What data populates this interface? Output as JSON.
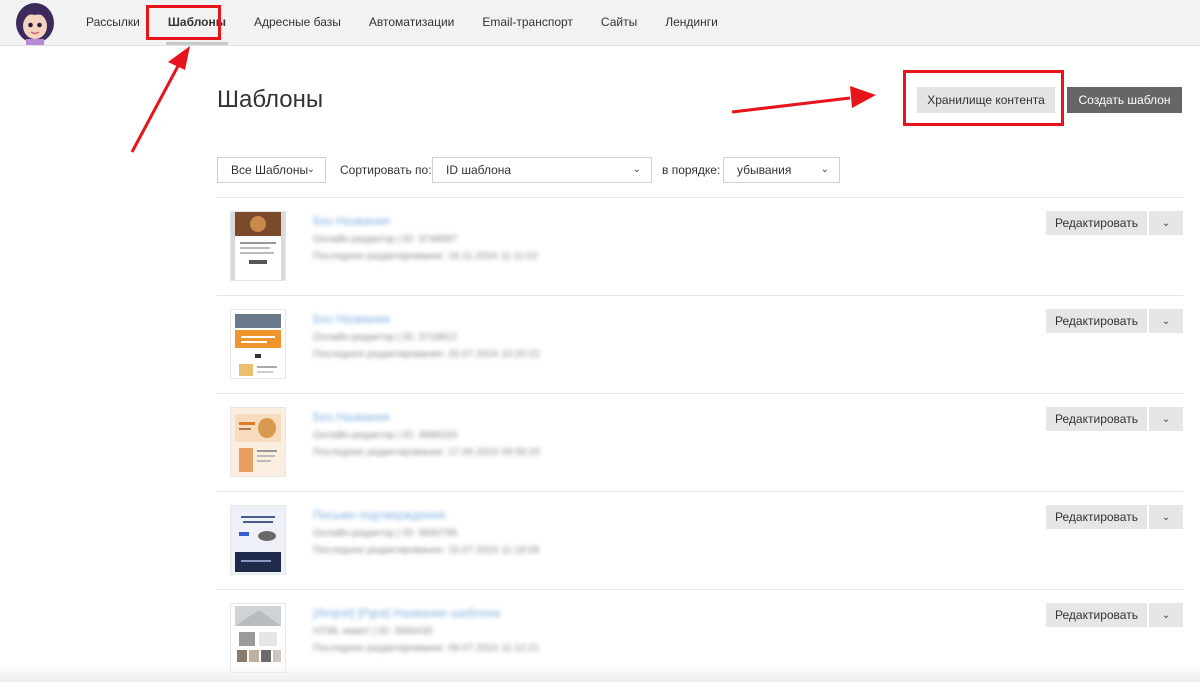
{
  "nav": {
    "items": [
      {
        "label": "Рассылки"
      },
      {
        "label": "Шаблоны",
        "active": true
      },
      {
        "label": "Адресные базы"
      },
      {
        "label": "Автоматизации"
      },
      {
        "label": "Email-транспорт"
      },
      {
        "label": "Сайты"
      },
      {
        "label": "Лендинги"
      }
    ]
  },
  "page": {
    "title": "Шаблоны",
    "storage_button": "Хранилище контента",
    "create_button": "Создать шаблон"
  },
  "filters": {
    "all_templates": "Все Шаблоны",
    "sort_label": "Сортировать по:",
    "sort_value": "ID шаблона",
    "order_label": "в порядке:",
    "order_value": "убывания"
  },
  "templates": [
    {
      "name": "Без Названия",
      "editor": "Онлайн-редактор | ID: 3748097",
      "edited": "Последнее редактирование: 16.11.2024 11:11:02",
      "edit_label": "Редактировать"
    },
    {
      "name": "Без Названия",
      "editor": "Онлайн-редактор | ID: 3718812",
      "edited": "Последнее редактирование: 20.07.2024 10:20:22",
      "edit_label": "Редактировать"
    },
    {
      "name": "Без Названия",
      "editor": "Онлайн-редактор | ID: 3689320",
      "edited": "Последнее редактирование: 17.06.2024 09:58:20",
      "edit_label": "Редактировать"
    },
    {
      "name": "Письмо подтверждения",
      "editor": "Онлайн-редактор | ID: 3650795",
      "edited": "Последнее редактирование: 15.07.2024 11:18:09",
      "edit_label": "Редактировать"
    },
    {
      "name": "[Amjret] [Pgrø] Название шаблона",
      "editor": "HTML-макет | ID: 3584430",
      "edited": "Последнее редактирование: 09.07.2024 11:12:21",
      "edit_label": "Редактировать"
    }
  ],
  "colors": {
    "highlight": "#e8141b",
    "create_button_bg": "#666666",
    "link_blue": "#7fb0e0"
  },
  "icons": {
    "chevron": "chevron-down-icon"
  }
}
